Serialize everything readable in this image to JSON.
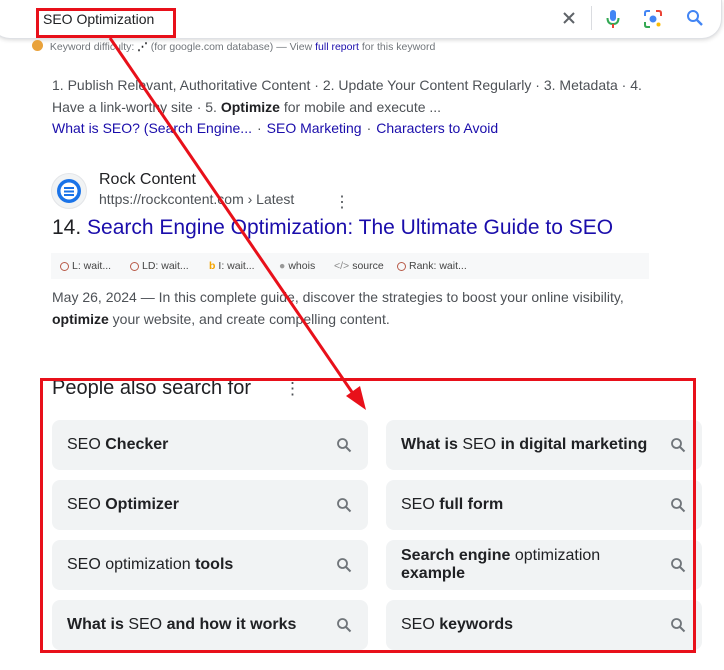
{
  "search": {
    "query": "SEO Optimization",
    "clear_icon": "close-icon",
    "voice_icon": "microphone-icon",
    "lens_icon": "camera-lens-icon",
    "search_icon": "search-icon"
  },
  "keyword_difficulty": {
    "label": "Keyword difficulty:",
    "value": "⋰",
    "note": "(for google.com database) — View",
    "link": "full report",
    "suffix": "for this keyword"
  },
  "prev_result": {
    "snippet_line1": "1. Publish Relevant, Authoritative Content · 2. Update Your Content Regularly · 3. Metadata · 4.",
    "snippet_line2_a": "Have a link-worthy site · 5. ",
    "snippet_line2_bold": "Optimize",
    "snippet_line2_b": " for mobile and execute ...",
    "sitelinks": [
      "What is SEO? (Search Engine...",
      "SEO Marketing",
      "Characters to Avoid"
    ]
  },
  "result": {
    "site_name": "Rock Content",
    "site_url": "https://rockcontent.com › Latest",
    "number": "14.",
    "title": "Search Engine Optimization: The Ultimate Guide to SEO",
    "metrics": {
      "l": "L: wait...",
      "ld": "LD: wait...",
      "i": "I: wait...",
      "whois": "whois",
      "source": "source",
      "rank": "Rank: wait..."
    },
    "date": "May 26, 2024",
    "desc_a": " — In this complete guide, discover the strategies to boost your online visibility,",
    "desc_bold": "optimize",
    "desc_b": " your website, and create compelling content."
  },
  "people_also_search": {
    "title": "People also search for",
    "items": [
      {
        "pre": "SEO ",
        "bold": "Checker",
        "post": ""
      },
      {
        "pre": "",
        "bold": "What is",
        "mid": " SEO ",
        "bold2": "in digital marketing"
      },
      {
        "pre": "SEO ",
        "bold": "Optimizer",
        "post": ""
      },
      {
        "pre": "SEO ",
        "bold": "full form",
        "post": ""
      },
      {
        "pre": "SEO optimization ",
        "bold": "tools",
        "post": ""
      },
      {
        "pre": "",
        "bold": "Search engine",
        "mid": " optimization ",
        "bold2": "example"
      },
      {
        "pre": "",
        "bold": "What is",
        "mid": " SEO ",
        "bold2": "and how it works"
      },
      {
        "pre": "SEO ",
        "bold": "keywords",
        "post": ""
      }
    ]
  },
  "colors": {
    "annotation": "#e8101a",
    "link": "#1a0dab"
  }
}
